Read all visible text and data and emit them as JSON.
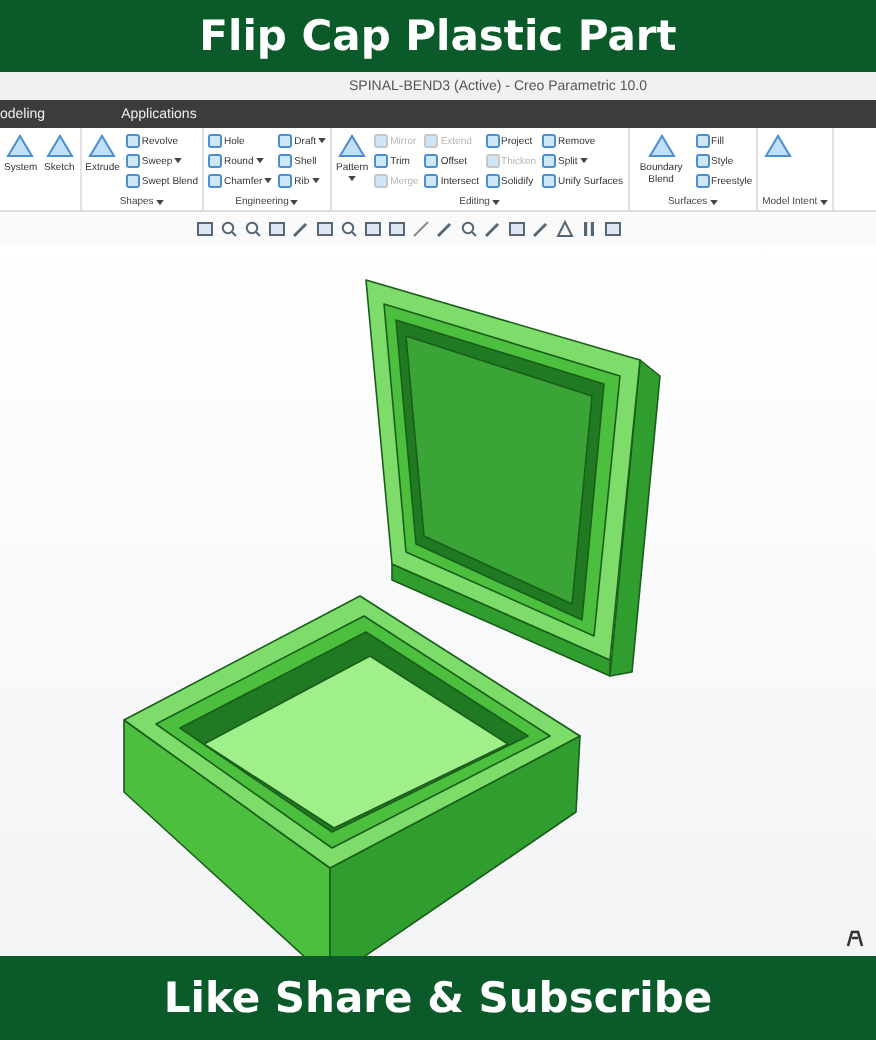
{
  "header": {
    "title": "Flip Cap Plastic Part"
  },
  "window": {
    "title": "SPINAL-BEND3 (Active) - Creo Parametric 10.0"
  },
  "tabs": [
    {
      "label": "odeling"
    },
    {
      "label": "Applications"
    }
  ],
  "ribbon": {
    "groups": [
      {
        "columns": [
          [
            {
              "label": "System",
              "kind": "large",
              "disabled": false,
              "menu": false
            }
          ],
          [
            {
              "label": "Sketch",
              "kind": "large",
              "disabled": false,
              "menu": false
            }
          ]
        ]
      },
      {
        "label": "Shapes",
        "menu": true,
        "columns": [
          [
            {
              "label": "Extrude",
              "kind": "large",
              "disabled": false,
              "menu": false
            }
          ],
          [
            {
              "label": "Revolve",
              "kind": "small",
              "disabled": false,
              "menu": false
            },
            {
              "label": "Sweep",
              "kind": "small",
              "disabled": false,
              "menu": true
            },
            {
              "label": "Swept Blend",
              "kind": "small",
              "disabled": false,
              "menu": false
            }
          ]
        ]
      },
      {
        "label": "Engineering",
        "menu": true,
        "columns": [
          [
            {
              "label": "Hole",
              "kind": "small",
              "disabled": false,
              "menu": false
            },
            {
              "label": "Round",
              "kind": "small",
              "disabled": false,
              "menu": true
            },
            {
              "label": "Chamfer",
              "kind": "small",
              "disabled": false,
              "menu": true
            }
          ],
          [
            {
              "label": "Draft",
              "kind": "small",
              "disabled": false,
              "menu": true
            },
            {
              "label": "Shell",
              "kind": "small",
              "disabled": false,
              "menu": false
            },
            {
              "label": "Rib",
              "kind": "small",
              "disabled": false,
              "menu": true
            }
          ]
        ]
      },
      {
        "label": "Editing",
        "menu": true,
        "columns": [
          [
            {
              "label": "Pattern",
              "kind": "large",
              "disabled": false,
              "menu": true
            }
          ],
          [
            {
              "label": "Mirror",
              "kind": "small",
              "disabled": true,
              "menu": false
            },
            {
              "label": "Trim",
              "kind": "small",
              "disabled": false,
              "menu": false
            },
            {
              "label": "Merge",
              "kind": "small",
              "disabled": true,
              "menu": false
            }
          ],
          [
            {
              "label": "Extend",
              "kind": "small",
              "disabled": true,
              "menu": false
            },
            {
              "label": "Offset",
              "kind": "small",
              "disabled": false,
              "menu": false
            },
            {
              "label": "Intersect",
              "kind": "small",
              "disabled": false,
              "menu": false
            }
          ],
          [
            {
              "label": "Project",
              "kind": "small",
              "disabled": false,
              "menu": false
            },
            {
              "label": "Thicken",
              "kind": "small",
              "disabled": true,
              "menu": false
            },
            {
              "label": "Solidify",
              "kind": "small",
              "disabled": false,
              "menu": false
            }
          ],
          [
            {
              "label": "Remove",
              "kind": "small",
              "disabled": false,
              "menu": false
            },
            {
              "label": "Split",
              "kind": "small",
              "disabled": false,
              "menu": true
            },
            {
              "label": "Unify Surfaces",
              "kind": "small",
              "disabled": false,
              "menu": false
            }
          ]
        ]
      },
      {
        "label": "Surfaces",
        "menu": true,
        "columns": [
          [
            {
              "label": "Boundary Blend",
              "kind": "large",
              "disabled": false,
              "menu": false
            }
          ],
          [
            {
              "label": "Fill",
              "kind": "small",
              "disabled": false,
              "menu": false
            },
            {
              "label": "Style",
              "kind": "small",
              "disabled": false,
              "menu": false
            },
            {
              "label": "Freestyle",
              "kind": "small",
              "disabled": false,
              "menu": false
            }
          ]
        ]
      },
      {
        "label": "Model Intent",
        "menu": true,
        "columns": [
          [
            {
              "kind": "large",
              "disabled": false,
              "menu": false
            }
          ]
        ]
      }
    ]
  },
  "footer": {
    "title": "Like Share & Subscribe"
  }
}
